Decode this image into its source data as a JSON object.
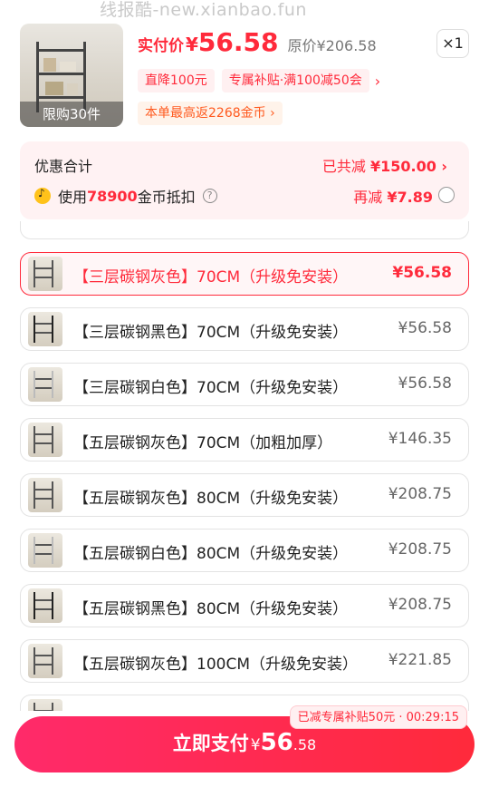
{
  "watermark": "线报酷-new.xianbao.fun",
  "product": {
    "limit_badge": "限购30件",
    "price_label": "实付价",
    "price_yen": "¥",
    "price_value": "56.58",
    "original_price": "原价¥206.58",
    "quantity": "×1",
    "tags": [
      "直降100元",
      "专属补贴·满100减50会"
    ],
    "coin_return": "本单最高返2268金币 ›"
  },
  "summary": {
    "title": "优惠合计",
    "total_prefix": "已共减",
    "total_value": "¥150.00 ›",
    "coin_use_prefix": "使用",
    "coin_amount": "78900",
    "coin_use_suffix": "金币抵扣",
    "extra_off_prefix": "再减",
    "extra_off_value": "¥7.89"
  },
  "options": [
    {
      "name": "【三层碳钢灰色】70CM（升级免安装）",
      "price": "¥56.58",
      "selected": true,
      "tone": "gray"
    },
    {
      "name": "【三层碳钢黑色】70CM（升级免安装）",
      "price": "¥56.58",
      "selected": false,
      "tone": "black"
    },
    {
      "name": "【三层碳钢白色】70CM（升级免安装）",
      "price": "¥56.58",
      "selected": false,
      "tone": "white"
    },
    {
      "name": "【五层碳钢灰色】70CM（加粗加厚）",
      "price": "¥146.35",
      "selected": false,
      "tone": "gray"
    },
    {
      "name": "【五层碳钢灰色】80CM（升级免安装）",
      "price": "¥208.75",
      "selected": false,
      "tone": "gray"
    },
    {
      "name": "【五层碳钢白色】80CM（升级免安装）",
      "price": "¥208.75",
      "selected": false,
      "tone": "white"
    },
    {
      "name": "【五层碳钢黑色】80CM（升级免安装）",
      "price": "¥208.75",
      "selected": false,
      "tone": "black"
    },
    {
      "name": "【五层碳钢灰色】100CM（升级免安装）",
      "price": "¥221.85",
      "selected": false,
      "tone": "gray"
    }
  ],
  "footer": {
    "timer_tip": "已减专属补贴50元 · 00:29:15",
    "pay_label": "立即支付",
    "pay_yen": "¥",
    "pay_int": "56",
    "pay_dec": ".58"
  },
  "colors": {
    "accent": "#ff2a3b",
    "button_gradient_start": "#ff2a6a",
    "summary_bg": "#fff2f3"
  }
}
